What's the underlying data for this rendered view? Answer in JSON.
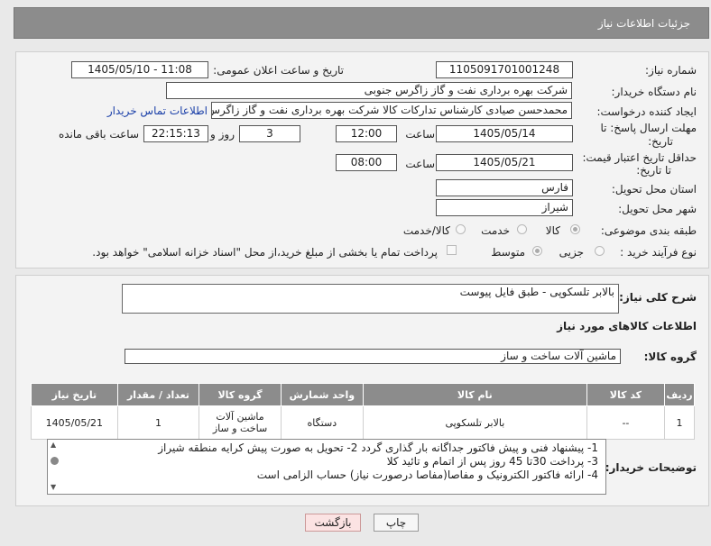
{
  "header": {
    "title": "جزئیات اطلاعات نیاز"
  },
  "form": {
    "need_number_label": "شماره نیاز:",
    "need_number": "1105091701001248",
    "announce_label": "تاریخ و ساعت اعلان عمومی:",
    "announce_value": "1405/05/10 - 11:08",
    "buyer_org_label": "نام دستگاه خریدار:",
    "buyer_org": "شرکت بهره برداری نفت و گاز زاگرس جنوبی",
    "requester_label": "ایجاد کننده درخواست:",
    "requester": "محمدحسن صیادی کارشناس تدارکات کالا شرکت بهره برداری نفت و گاز زاگرس",
    "contact_link": "اطلاعات تماس خریدار",
    "reply_deadline_label_1": "مهلت ارسال پاسخ: تا",
    "reply_deadline_label_2": "تاریخ:",
    "reply_date": "1405/05/14",
    "time_label": "ساعت",
    "reply_time": "12:00",
    "days_value": "3",
    "days_label": "روز و",
    "remaining_time": "22:15:13",
    "remaining_label": "ساعت باقی مانده",
    "price_validity_label_1": "حداقل تاریخ اعتبار قیمت:",
    "price_validity_label_2": "تا تاریخ:",
    "validity_date": "1405/05/21",
    "validity_time_label": "ساعت",
    "validity_time": "08:00",
    "province_label": "استان محل تحویل:",
    "province": "فارس",
    "city_label": "شهر محل تحویل:",
    "city": "شیراز",
    "category_label": "طبقه بندی موضوعی:",
    "category_options": [
      "کالا",
      "خدمت",
      "کالا/خدمت"
    ],
    "category_selected": "کالا",
    "process_label": "نوع فرآیند خرید :",
    "process_options": [
      "جزیی",
      "متوسط"
    ],
    "process_selected": "متوسط",
    "payment_text": "پرداخت تمام یا بخشی از مبلغ خرید،از محل \"اسناد خزانه اسلامی\" خواهد بود."
  },
  "details": {
    "general_desc_label": "شرح کلی نیاز:",
    "general_desc": "بالابر تلسکوپی - طبق فایل پیوست",
    "goods_info_title": "اطلاعات کالاهای مورد نیاز",
    "goods_group_label": "گروه کالا:",
    "goods_group": "ماشین آلات ساخت و ساز"
  },
  "table": {
    "headers": [
      "ردیف",
      "کد کالا",
      "نام کالا",
      "واحد شمارش",
      "گروه کالا",
      "تعداد / مقدار",
      "تاریخ نیاز"
    ],
    "rows": [
      [
        "1",
        "--",
        "بالابر تلسکوپی",
        "دستگاه",
        "ماشین آلات ساخت و ساز",
        "1",
        "1405/05/21"
      ]
    ]
  },
  "notes": {
    "label": "توضیحات خریدار:",
    "lines": [
      "1- پیشنهاد فنی و پیش فاکتور  جداگانه  بار گذاری گردد 2- تحویل به صورت پیش کرایه منطقه شیراز",
      "3- پرداخت 30تا 45 روز پس از اتمام و تائید کلا",
      "4- ارائه فاکتور الکترونیک  و مفاصا(مفاصا درصورت نیاز) حساب  الزامی است"
    ]
  },
  "buttons": {
    "print": "چاپ",
    "back": "بازگشت"
  }
}
